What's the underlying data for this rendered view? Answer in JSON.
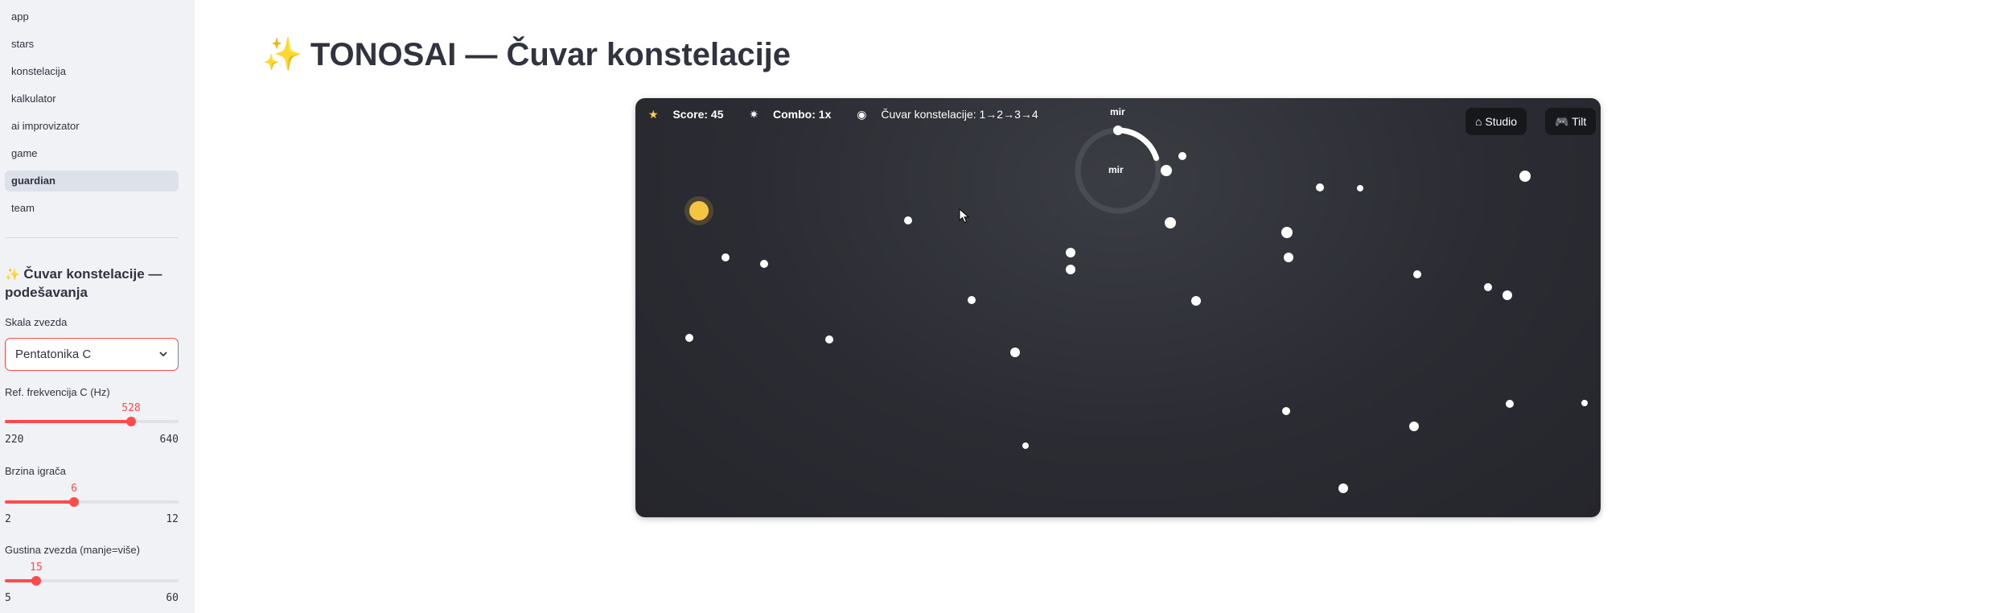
{
  "sidebar": {
    "nav": [
      {
        "label": "app",
        "active": false
      },
      {
        "label": "stars",
        "active": false
      },
      {
        "label": "konstelacija",
        "active": false
      },
      {
        "label": "kalkulator",
        "active": false
      },
      {
        "label": "ai improvizator",
        "active": false
      },
      {
        "label": "game",
        "active": false
      },
      {
        "label": "guardian",
        "active": true
      },
      {
        "label": "team",
        "active": false
      }
    ],
    "settings_icon": "sparkles-icon",
    "settings_title": "Čuvar konstelacije — podešavanja",
    "scale": {
      "label": "Skala zvezda",
      "value": "Pentatonika C"
    },
    "freq": {
      "label": "Ref. frekvencija C (Hz)",
      "value": "528",
      "min": "220",
      "max": "640",
      "fraction": 0.727
    },
    "speed": {
      "label": "Brzina igrača",
      "value": "6",
      "min": "2",
      "max": "12",
      "fraction": 0.4
    },
    "density": {
      "label": "Gustina zvezda (manje=više)",
      "value": "15",
      "min": "5",
      "max": "60",
      "fraction": 0.182
    }
  },
  "page": {
    "title_icon": "sparkles-icon",
    "title": "TONOSAI — Čuvar konstelacije"
  },
  "game": {
    "score": "Score: 45",
    "combo": "Combo: 1x",
    "mode": "Čuvar konstelacije: 1→2→3→4",
    "studio_label": "Studio",
    "tilt_label": "Tilt",
    "ring_top_label": "mir",
    "ring_center_label": "mir",
    "ring_progress": 0.2,
    "colors": {
      "player": "#f6c443",
      "star": "#ffffff",
      "background": "#2b2c33"
    }
  }
}
